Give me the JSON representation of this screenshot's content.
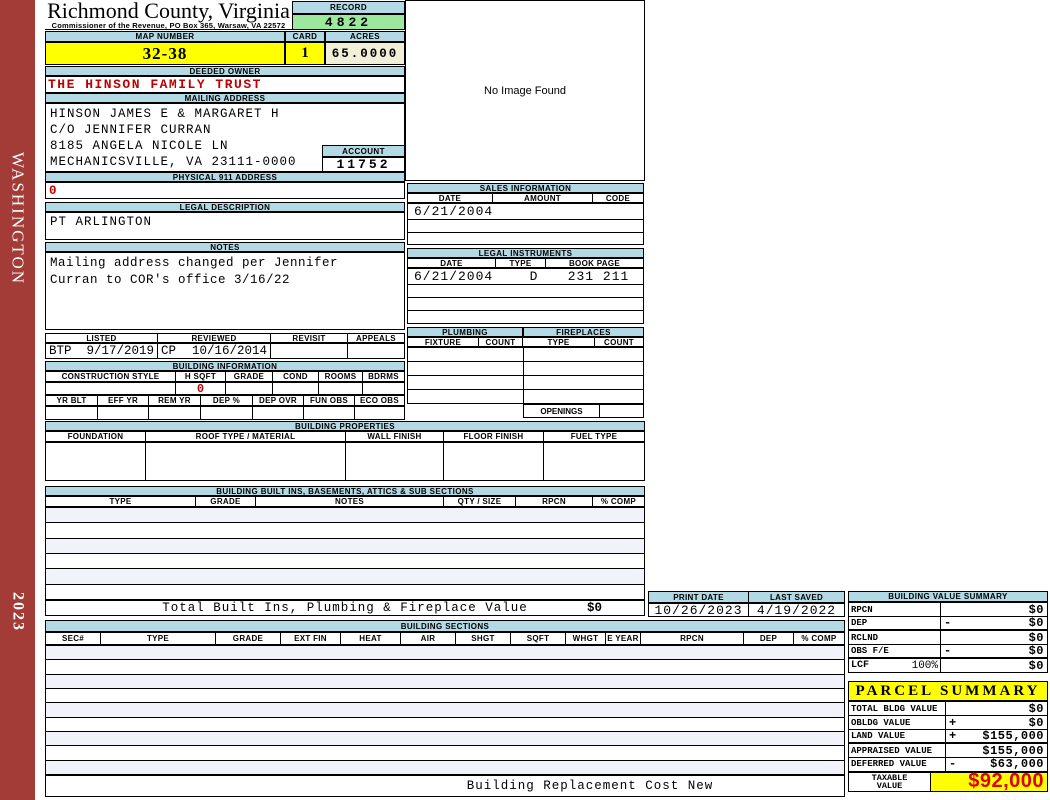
{
  "colors": {
    "header_bar_blue": "#B3D9E5",
    "record_green": "#9CE89C",
    "highlight_yellow": "#FFFF00",
    "acres_cream": "#F2EFD9",
    "alert_red": "#C00000",
    "taxable_red": "#E00000",
    "sidebar_red": "#A33B36"
  },
  "sidebar": {
    "district": "WASHINGTON",
    "year": "2023"
  },
  "header": {
    "county": "Richmond County, Virginia",
    "commissioner": "Commissioner of the Revenue, PO Box 365, Warsaw, VA 22572",
    "record_label": "RECORD",
    "record_value": "4822",
    "map_label": "MAP NUMBER",
    "map_value": "32-38",
    "card_label": "CARD",
    "card_value": "1",
    "acres_label": "ACRES",
    "acres_value": "65.0000"
  },
  "owner": {
    "label": "DEEDED OWNER",
    "value": "THE HINSON FAMILY TRUST"
  },
  "mailing": {
    "label": "MAILING ADDRESS",
    "line1": "HINSON JAMES E & MARGARET H",
    "line2": "C/O JENNIFER CURRAN",
    "line3": "8185 ANGELA NICOLE LN",
    "line4": "MECHANICSVILLE, VA 23111-0000"
  },
  "account": {
    "label": "ACCOUNT",
    "value": "11752"
  },
  "physical911": {
    "label": "PHYSICAL 911 ADDRESS",
    "value": "0"
  },
  "legal_description": {
    "label": "LEGAL DESCRIPTION",
    "value": "PT ARLINGTON"
  },
  "notes": {
    "label": "NOTES",
    "line1": "Mailing address changed per Jennifer",
    "line2": "Curran to COR's office 3/16/22"
  },
  "review": {
    "listed_label": "LISTED",
    "reviewed_label": "REVIEWED",
    "revisit_label": "REVISIT",
    "appeals_label": "APPEALS",
    "listed_by": "BTP",
    "listed_date": "9/17/2019",
    "reviewed_by": "CP",
    "reviewed_date": "10/16/2014"
  },
  "building_info": {
    "label": "BUILDING INFORMATION",
    "cols1": [
      "CONSTRUCTION STYLE",
      "H SQFT",
      "GRADE",
      "COND",
      "ROOMS",
      "BDRMS"
    ],
    "h_sqft_value": "0",
    "cols2": [
      "YR BLT",
      "EFF YR",
      "REM YR",
      "DEP %",
      "DEP OVR",
      "FUN OBS",
      "ECO OBS"
    ]
  },
  "image_panel": {
    "message": "No Image Found"
  },
  "sales": {
    "label": "SALES INFORMATION",
    "cols": [
      "DATE",
      "AMOUNT",
      "CODE"
    ],
    "row1_date": "6/21/2004"
  },
  "instruments": {
    "label": "LEGAL INSTRUMENTS",
    "cols": [
      "DATE",
      "TYPE",
      "BOOK PAGE"
    ],
    "row1_date": "6/21/2004",
    "row1_type": "D",
    "row1_bookpage": "231 211"
  },
  "plumbing": {
    "label": "PLUMBING",
    "cols": [
      "FIXTURE",
      "COUNT"
    ]
  },
  "fireplaces": {
    "label": "FIREPLACES",
    "cols": [
      "TYPE",
      "COUNT"
    ],
    "openings": "OPENINGS"
  },
  "properties": {
    "label": "BUILDING PROPERTIES",
    "cols": [
      "FOUNDATION",
      "ROOF TYPE / MATERIAL",
      "WALL FINISH",
      "FLOOR FINISH",
      "FUEL TYPE"
    ]
  },
  "built_ins": {
    "label": "BUILDING BUILT INS, BASEMENTS, ATTICS & SUB SECTIONS",
    "cols": [
      "TYPE",
      "GRADE",
      "NOTES",
      "QTY / SIZE",
      "RPCN",
      "% COMP"
    ],
    "total_label": "Total Built Ins, Plumbing & Fireplace Value",
    "total_value": "$0"
  },
  "print_info": {
    "print_label": "PRINT DATE",
    "print_date": "10/26/2023",
    "saved_label": "LAST SAVED",
    "saved_date": "4/19/2022"
  },
  "bvs": {
    "label": "BUILDING VALUE SUMMARY",
    "rows": [
      {
        "label": "RPCN",
        "pct": "",
        "op": "",
        "value": "$0"
      },
      {
        "label": "DEP",
        "pct": "",
        "op": "-",
        "value": "$0"
      },
      {
        "label": "RCLND",
        "pct": "",
        "op": "",
        "value": "$0"
      },
      {
        "label": "OBS F/E",
        "pct": "",
        "op": "-",
        "value": "$0"
      },
      {
        "label": "LCF",
        "pct": "100%",
        "op": "",
        "value": "$0"
      }
    ]
  },
  "sections": {
    "label": "BUILDING SECTIONS",
    "cols": [
      "SEC#",
      "TYPE",
      "GRADE",
      "EXT FIN",
      "HEAT",
      "AIR",
      "SHGT",
      "SQFT",
      "WHGT",
      "E YEAR",
      "RPCN",
      "DEP",
      "% COMP"
    ],
    "footer": "Building Replacement Cost New"
  },
  "parcel": {
    "label": "PARCEL SUMMARY",
    "rows": [
      {
        "label": "TOTAL BLDG VALUE",
        "op": "",
        "value": "$0"
      },
      {
        "label": "OBLDG VALUE",
        "op": "+",
        "value": "$0"
      },
      {
        "label": "LAND VALUE",
        "op": "+",
        "value": "$155,000"
      },
      {
        "label": "APPRAISED VALUE",
        "op": "",
        "value": "$155,000"
      },
      {
        "label": "DEFERRED VALUE",
        "op": "-",
        "value": "$63,000"
      }
    ],
    "taxable_label_1": "TAXABLE",
    "taxable_label_2": "VALUE",
    "taxable_value": "$92,000"
  }
}
